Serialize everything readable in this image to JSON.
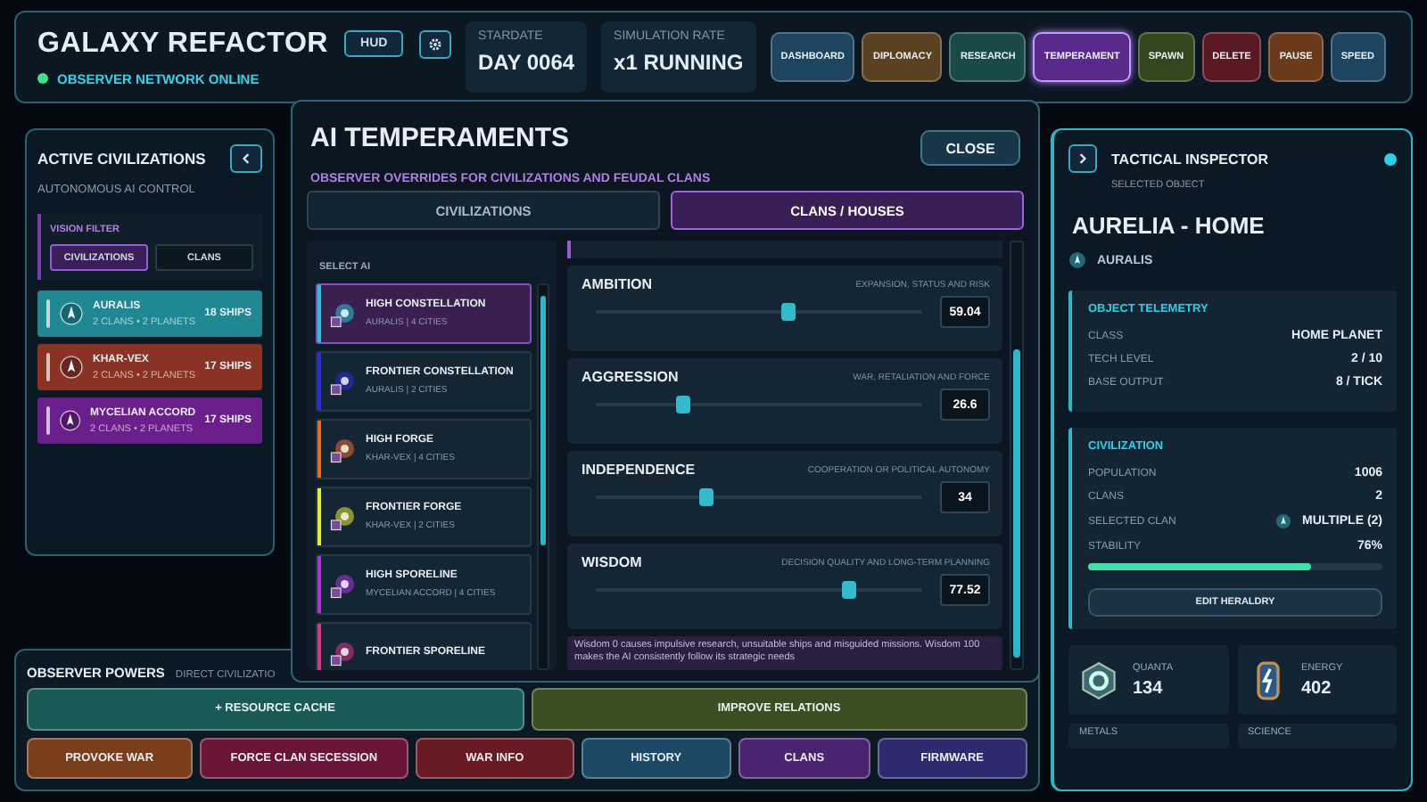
{
  "app": {
    "title": "GALAXY REFACTOR",
    "hud_button": "HUD",
    "status": "OBSERVER NETWORK ONLINE",
    "online": true
  },
  "readouts": [
    {
      "label": "STARDATE",
      "value": "DAY 0064"
    },
    {
      "label": "SIMULATION RATE",
      "value": "x1 RUNNING"
    }
  ],
  "nav": [
    {
      "label": "DASHBOARD",
      "color": "#1d4560",
      "selected": false
    },
    {
      "label": "DIPLOMACY",
      "color": "#5a4220",
      "selected": false
    },
    {
      "label": "RESEARCH",
      "color": "#1a4a48",
      "selected": false
    },
    {
      "label": "TEMPERAMENT",
      "color": "#5a2a8a",
      "selected": true
    },
    {
      "label": "SPAWN",
      "color": "#34461e",
      "selected": false
    },
    {
      "label": "DELETE",
      "color": "#5a1a24",
      "selected": false
    },
    {
      "label": "PAUSE",
      "color": "#6a3a1a",
      "selected": false
    },
    {
      "label": "SPEED",
      "color": "#1d4560",
      "selected": false
    }
  ],
  "civilizations_panel": {
    "title": "ACTIVE CIVILIZATIONS",
    "subtitle": "AUTONOMOUS AI CONTROL",
    "filter_label": "VISION FILTER",
    "filters": [
      {
        "label": "CIVILIZATIONS",
        "selected": true
      },
      {
        "label": "CLANS",
        "selected": false
      }
    ],
    "items": [
      {
        "name": "AURALIS",
        "details": "2 CLANS • 2 PLANETS",
        "ships": "18 SHIPS",
        "color": "#1f8893"
      },
      {
        "name": "KHAR-VEX",
        "details": "2 CLANS • 2 PLANETS",
        "ships": "17 SHIPS",
        "color": "#8a3324"
      },
      {
        "name": "MYCELIAN ACCORD",
        "details": "2 CLANS • 2 PLANETS",
        "ships": "17 SHIPS",
        "color": "#6a1f8a"
      }
    ]
  },
  "modal": {
    "title": "AI TEMPERAMENTS",
    "subtitle": "OBSERVER OVERRIDES FOR CIVILIZATIONS AND FEUDAL CLANS",
    "close": "CLOSE",
    "tabs": [
      {
        "label": "CIVILIZATIONS",
        "selected": false
      },
      {
        "label": "CLANS / HOUSES",
        "selected": true
      }
    ],
    "list_label": "SELECT AI",
    "ais": [
      {
        "name": "HIGH CONSTELLATION",
        "details": "AURALIS | 4 CITIES",
        "color": "#22c4d8",
        "selected": true
      },
      {
        "name": "FRONTIER CONSTELLATION",
        "details": "AURALIS | 2 CITIES",
        "color": "#2a2ae0",
        "selected": false
      },
      {
        "name": "HIGH FORGE",
        "details": "KHAR-VEX | 4 CITIES",
        "color": "#f06a20",
        "selected": false
      },
      {
        "name": "FRONTIER FORGE",
        "details": "KHAR-VEX | 2 CITIES",
        "color": "#e8f020",
        "selected": false
      },
      {
        "name": "HIGH SPORELINE",
        "details": "MYCELIAN ACCORD | 4 CITIES",
        "color": "#b030e0",
        "selected": false
      },
      {
        "name": "FRONTIER SPORELINE",
        "color": "#e0308a",
        "selected": false
      }
    ],
    "traits": [
      {
        "name": "AMBITION",
        "hint": "EXPANSION, STATUS AND RISK",
        "level": 0.5904,
        "value": "59.04"
      },
      {
        "name": "AGGRESSION",
        "hint": "WAR, RETALIATION AND FORCE",
        "level": 0.266,
        "value": "26.6"
      },
      {
        "name": "INDEPENDENCE",
        "hint": "COOPERATION OR POLITICAL AUTONOMY",
        "level": 0.34,
        "value": "34"
      },
      {
        "name": "WISDOM",
        "hint": "DECISION QUALITY AND LONG-TERM PLANNING",
        "level": 0.7752,
        "value": "77.52"
      }
    ],
    "note": "Wisdom 0 causes impulsive research, unsuitable ships and misguided missions. Wisdom 100 makes the AI consistently follow its strategic needs"
  },
  "inspector": {
    "title": "TACTICAL INSPECTOR",
    "subtitle": "SELECTED OBJECT",
    "object": "AURELIA - HOME",
    "owner": "AURALIS",
    "sections": [
      {
        "title": "OBJECT TELEMETRY",
        "rows": [
          {
            "kind": "plain",
            "label": "CLASS",
            "value": "HOME PLANET"
          },
          {
            "kind": "plain",
            "label": "TECH LEVEL",
            "value": "2 / 10"
          },
          {
            "kind": "plain",
            "label": "BASE OUTPUT",
            "value": "8 / TICK"
          }
        ]
      },
      {
        "title": "CIVILIZATION",
        "rows": [
          {
            "kind": "plain",
            "label": "POPULATION",
            "value": "1006"
          },
          {
            "kind": "plain",
            "label": "CLANS",
            "value": "2"
          },
          {
            "kind": "clan",
            "label": "SELECTED CLAN",
            "value": "MULTIPLE (2)"
          },
          {
            "kind": "plain",
            "label": "STABILITY",
            "value": "76%"
          }
        ],
        "level": 0.76,
        "button": "EDIT HERALDRY"
      }
    ],
    "resources": [
      {
        "name": "QUANTA",
        "value": "134"
      },
      {
        "name": "ENERGY",
        "value": "402"
      },
      {
        "name": "METALS"
      },
      {
        "name": "SCIENCE"
      }
    ]
  },
  "powers": {
    "title": "OBSERVER POWERS",
    "subtitle": "DIRECT CIVILIZATIO",
    "primary": [
      {
        "label": "+ RESOURCE CACHE",
        "color": "#1a5a54"
      },
      {
        "label": "IMPROVE RELATIONS",
        "color": "#3a4e22"
      }
    ],
    "secondary": [
      {
        "label": "PROVOKE WAR",
        "color": "#7a3e1c"
      },
      {
        "label": "FORCE CLAN SECESSION",
        "color": "#6a1438"
      },
      {
        "label": "WAR INFO",
        "color": "#6a1a22"
      },
      {
        "label": "HISTORY",
        "color": "#1c4a66"
      },
      {
        "label": "CLANS",
        "color": "#4a2470"
      },
      {
        "label": "FIRMWARE",
        "color": "#2e2a6e"
      }
    ]
  }
}
